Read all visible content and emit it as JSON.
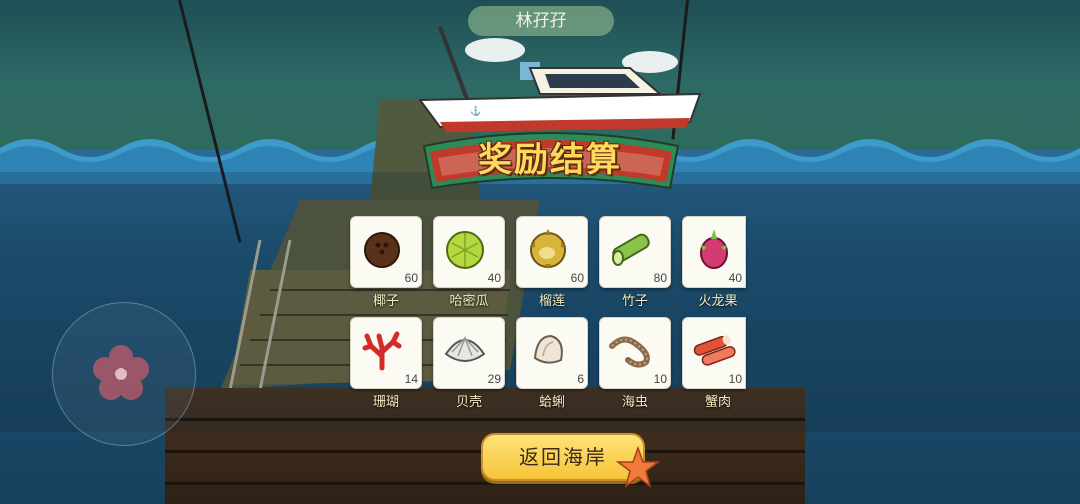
{
  "player": {
    "name": "林孖孖"
  },
  "banner": {
    "title": "奖励结算"
  },
  "rewards": [
    {
      "name": "椰子",
      "count": "60",
      "icon": "coconut-icon"
    },
    {
      "name": "哈密瓜",
      "count": "40",
      "icon": "melon-icon"
    },
    {
      "name": "榴莲",
      "count": "60",
      "icon": "durian-icon"
    },
    {
      "name": "竹子",
      "count": "80",
      "icon": "bamboo-icon"
    },
    {
      "name": "火龙果",
      "count": "40",
      "icon": "dragonfruit-icon"
    },
    {
      "name": "珊瑚",
      "count": "14",
      "icon": "coral-icon"
    },
    {
      "name": "贝壳",
      "count": "29",
      "icon": "shell-icon"
    },
    {
      "name": "蛤蜊",
      "count": "6",
      "icon": "clam-icon"
    },
    {
      "name": "海虫",
      "count": "10",
      "icon": "seaworm-icon"
    },
    {
      "name": "蟹肉",
      "count": "10",
      "icon": "crabmeat-icon"
    }
  ],
  "actions": {
    "return_label": "返回海岸"
  },
  "colors": {
    "button": "#f6c53a",
    "banner_red": "#c0392b",
    "banner_green": "#2e8b57",
    "title_gold": "#ffd95a"
  }
}
